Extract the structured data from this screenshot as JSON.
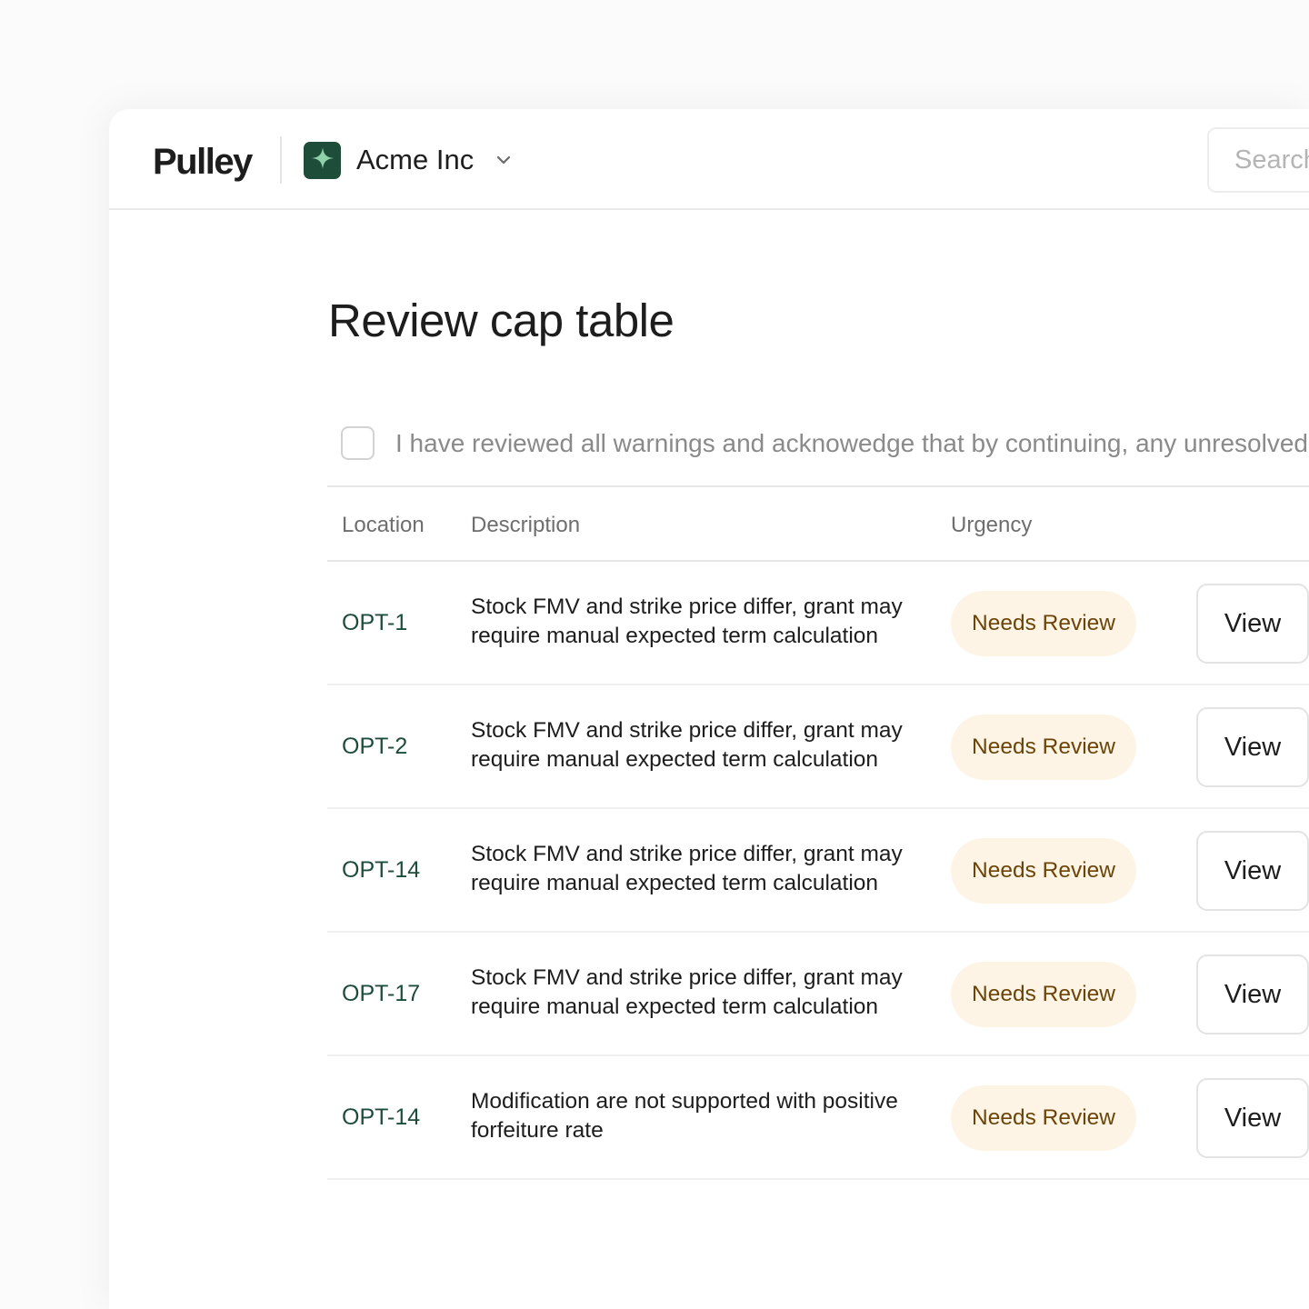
{
  "brand": {
    "logo_text": "Pulley",
    "accent": "#1e4e3a"
  },
  "org": {
    "name": "Acme Inc",
    "avatar_icon": "sparkle-icon",
    "chevron_icon": "chevron-down-icon"
  },
  "search": {
    "placeholder": "Search"
  },
  "page": {
    "title": "Review cap table"
  },
  "acknowledgement": {
    "checked": false,
    "text": "I have reviewed all warnings and acknowedge that by continuing, any unresolved"
  },
  "table": {
    "headers": {
      "location": "Location",
      "description": "Description",
      "urgency": "Urgency"
    },
    "rows": [
      {
        "location": "OPT-1",
        "description": "Stock FMV and strike price differ, grant may require manual expected term calculation",
        "urgency": "Needs Review",
        "action": "View"
      },
      {
        "location": "OPT-2",
        "description": "Stock FMV and strike price differ, grant may require manual expected term calculation",
        "urgency": "Needs Review",
        "action": "View"
      },
      {
        "location": "OPT-14",
        "description": "Stock FMV and strike price differ, grant may require manual expected term calculation",
        "urgency": "Needs Review",
        "action": "View"
      },
      {
        "location": "OPT-17",
        "description": "Stock FMV and strike price differ, grant may require manual expected term calculation",
        "urgency": "Needs Review",
        "action": "View"
      },
      {
        "location": "OPT-14",
        "description": "Modification are not supported with positive forfeiture rate",
        "urgency": "Needs Review",
        "action": "View"
      }
    ]
  },
  "colors": {
    "location_text": "#1d4d38",
    "badge_bg": "#fdf4e6",
    "badge_text": "#6b4508"
  }
}
